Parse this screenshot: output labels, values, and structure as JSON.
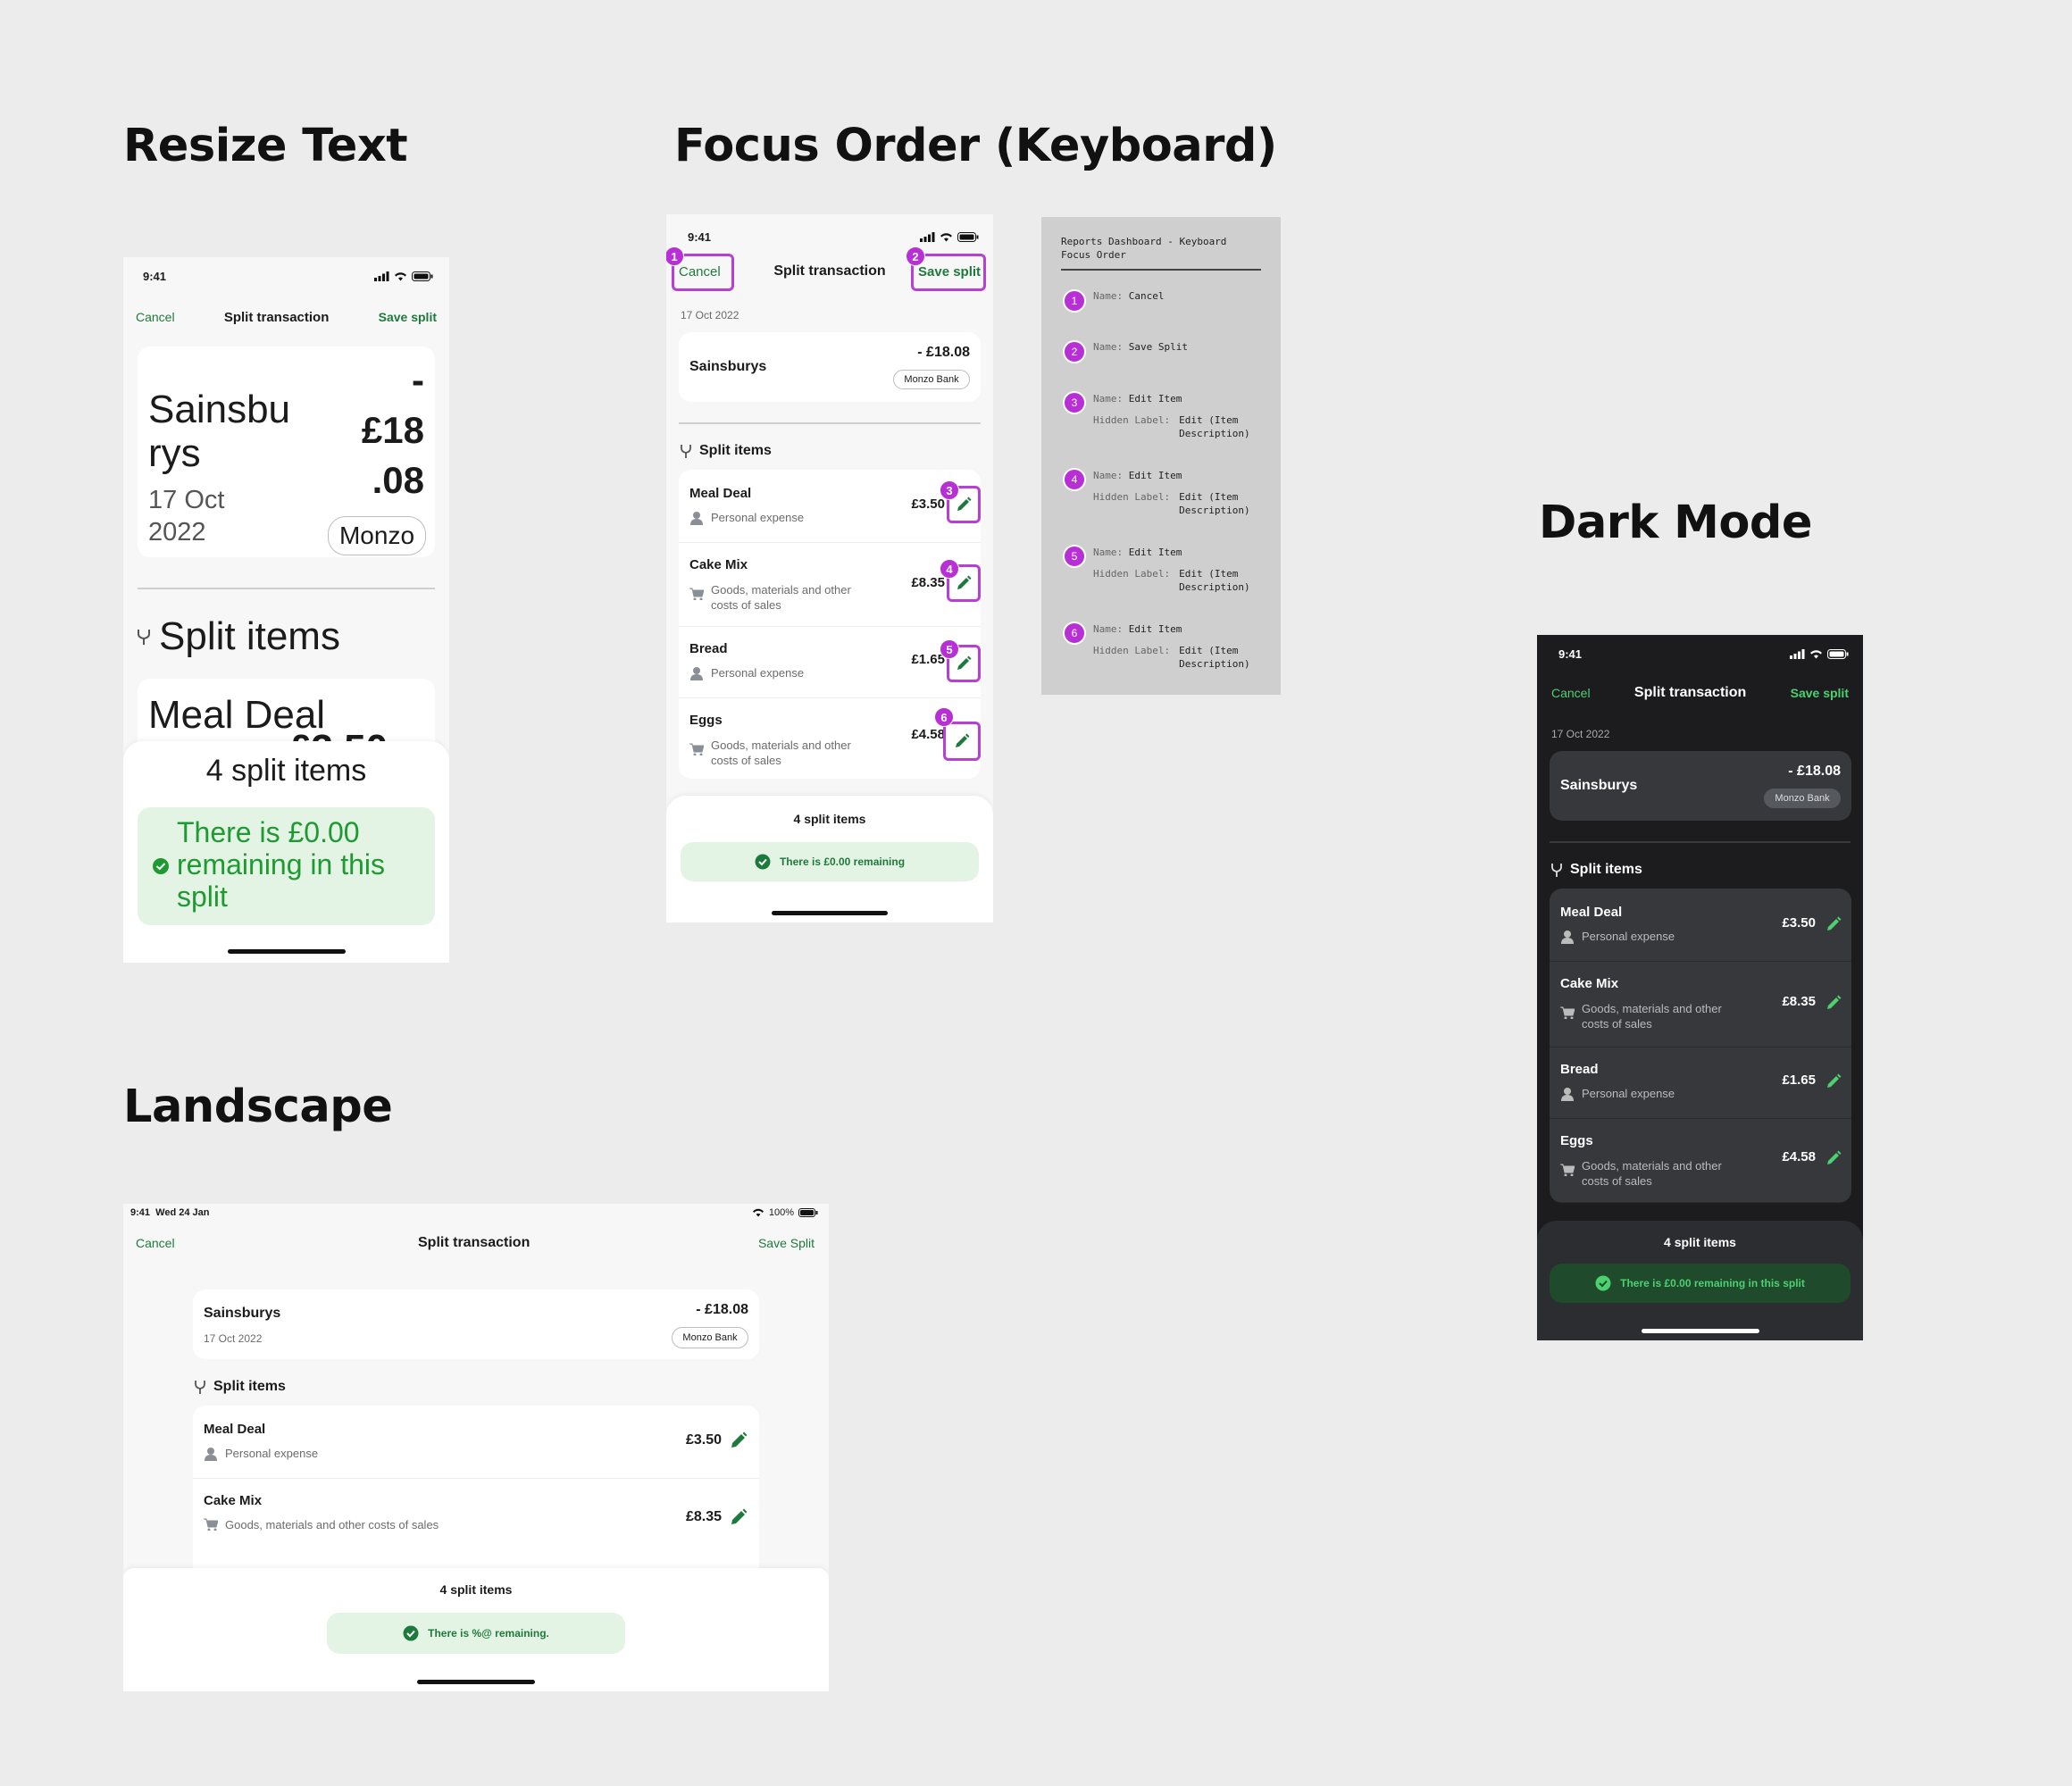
{
  "sections": {
    "resize": "Resize Text",
    "focus": "Focus Order (Keyboard)",
    "dark": "Dark Mode",
    "landscape": "Landscape"
  },
  "status": {
    "time": "9:41",
    "date": "Wed 24 Jan",
    "battery": "100%"
  },
  "nav": {
    "cancel": "Cancel",
    "title": "Split transaction",
    "save": "Save split",
    "save_landscape": "Save Split"
  },
  "transaction": {
    "merchant": "Sainsburys",
    "merchant_l1": "Sainsbu",
    "merchant_l2": "rys",
    "date": "17 Oct 2022",
    "date_l1": "17 Oct",
    "date_l2": "2022",
    "amount": "- £18.08",
    "amount_l1": "-",
    "amount_l2": "£18",
    "amount_l3": ".08",
    "bank": "Monzo Bank",
    "bank_short": "Monzo"
  },
  "split": {
    "heading": "Split items",
    "items": [
      {
        "name": "Meal Deal",
        "category": "Personal expense",
        "amount": "£3.50"
      },
      {
        "name": "Cake Mix",
        "category": "Goods, materials and other costs of sales",
        "cat_l1": "Goods, materials and other",
        "cat_l2": "costs of sales",
        "amount": "£8.35"
      },
      {
        "name": "Bread",
        "category": "Personal expense",
        "amount": "£1.65"
      },
      {
        "name": "Eggs",
        "category": "Goods, materials and other costs of sales",
        "cat_l1": "Goods, materials and other",
        "cat_l2": "costs of sales",
        "amount": "£4.58"
      }
    ],
    "partial_amount": "£3.50"
  },
  "summary": {
    "count": "4 split items",
    "remaining_short": "There is £0.00 remaining",
    "remaining_full": "There is £0.00 remaining in this split",
    "remaining_l1": "There is £0.00",
    "remaining_l2": "remaining in this",
    "remaining_l3": "split",
    "remaining_placeholder": "There is %@ remaining."
  },
  "focus_order": {
    "title_l1": "Reports Dashboard - Keyboard",
    "title_l2": "Focus Order",
    "name_label": "Name:",
    "hidden_label": "Hidden Label:",
    "entries": [
      {
        "n": "1",
        "name": "Cancel"
      },
      {
        "n": "2",
        "name": "Save Split"
      },
      {
        "n": "3",
        "name": "Edit Item",
        "hidden_l1": "Edit (Item",
        "hidden_l2": "Description)"
      },
      {
        "n": "4",
        "name": "Edit Item",
        "hidden_l1": "Edit (Item",
        "hidden_l2": "Description)"
      },
      {
        "n": "5",
        "name": "Edit Item",
        "hidden_l1": "Edit (Item",
        "hidden_l2": "Description)"
      },
      {
        "n": "6",
        "name": "Edit Item",
        "hidden_l1": "Edit (Item",
        "hidden_l2": "Description)"
      }
    ]
  },
  "colors": {
    "accent": "#1e7a3c",
    "focus": "#b82fd6",
    "banner": "#e4f4e4",
    "dark_bg": "#1c1c1e",
    "dark_card": "#36383c",
    "dark_accent": "#4cd070"
  }
}
